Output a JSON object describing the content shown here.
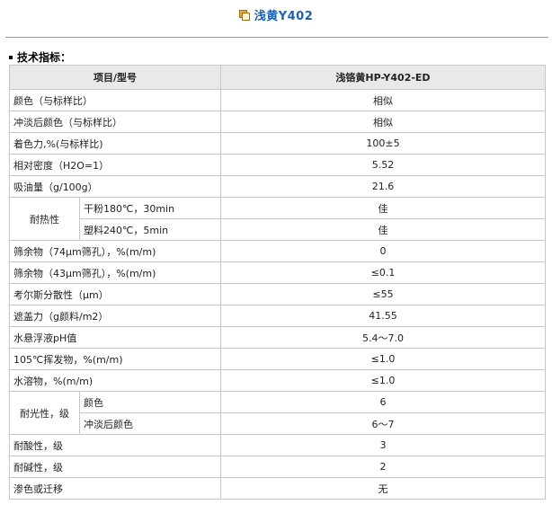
{
  "page": {
    "title": "浅黄Y402",
    "section_title": "技术指标："
  },
  "table": {
    "headers": [
      "项目/型号",
      "浅铬黄HP-Y402-ED"
    ],
    "rows": [
      {
        "item": "颜色（与标样比）",
        "value": "相似"
      },
      {
        "item": "冲淡后颜色（与标样比）",
        "value": "相似"
      },
      {
        "item": "着色力,%(与标样比)",
        "value": "100±5"
      },
      {
        "item": "相对密度（H2O=1）",
        "value": "5.52"
      },
      {
        "item": "吸油量（g/100g）",
        "value": "21.6"
      },
      {
        "group": "耐热性",
        "sub": [
          {
            "item": "干粉180℃，30min",
            "value": "佳"
          },
          {
            "item": "塑料240℃，5min",
            "value": "佳"
          }
        ]
      },
      {
        "item": "筛余物（74μm筛孔），%(m/m)",
        "value": "0"
      },
      {
        "item": "筛余物（43μm筛孔），%(m/m)",
        "value": "≤0.1"
      },
      {
        "item": "考尔斯分散性（μm）",
        "value": "≤55"
      },
      {
        "item": "遮盖力（g颜料/m2）",
        "value": "41.55"
      },
      {
        "item": "水悬浮液pH值",
        "value": "5.4～7.0"
      },
      {
        "item": "105℃挥发物，%(m/m)",
        "value": "≤1.0"
      },
      {
        "item": "水溶物，%(m/m)",
        "value": "≤1.0"
      },
      {
        "group": "耐光性，级",
        "sub": [
          {
            "item": "颜色",
            "value": "6"
          },
          {
            "item": "冲淡后颜色",
            "value": "6～7"
          }
        ]
      },
      {
        "item": "耐酸性，级",
        "value": "3"
      },
      {
        "item": "耐碱性，级",
        "value": "2"
      },
      {
        "item": "渗色或迁移",
        "value": "无"
      }
    ]
  }
}
